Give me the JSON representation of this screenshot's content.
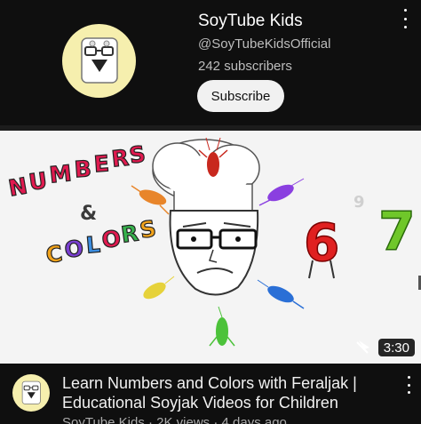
{
  "channel": {
    "name": "SoyTube Kids",
    "handle": "@SoyTubeKidsOfficial",
    "subscribers": "242 subscribers",
    "subscribe_label": "Subscribe",
    "avatar_icon": "soyjak-mascot-icon",
    "avatar_bg": "#f6efae"
  },
  "thumbnail": {
    "duration": "3:30",
    "text_numbers": "NUMBERS",
    "text_and": "&",
    "text_colors": "COLORS",
    "digit_6": "6",
    "digit_7": "7",
    "digit_9": "9"
  },
  "video": {
    "title": "Learn Numbers and Colors with Feraljak | Educational Soyjak Videos for Children",
    "meta": "SoyTube Kids · 2K views · 4 days ago"
  },
  "colors": {
    "background": "#0f0f0f",
    "subscribe_bg": "#f1f1f1",
    "secondary_text": "#aaaaaa"
  }
}
